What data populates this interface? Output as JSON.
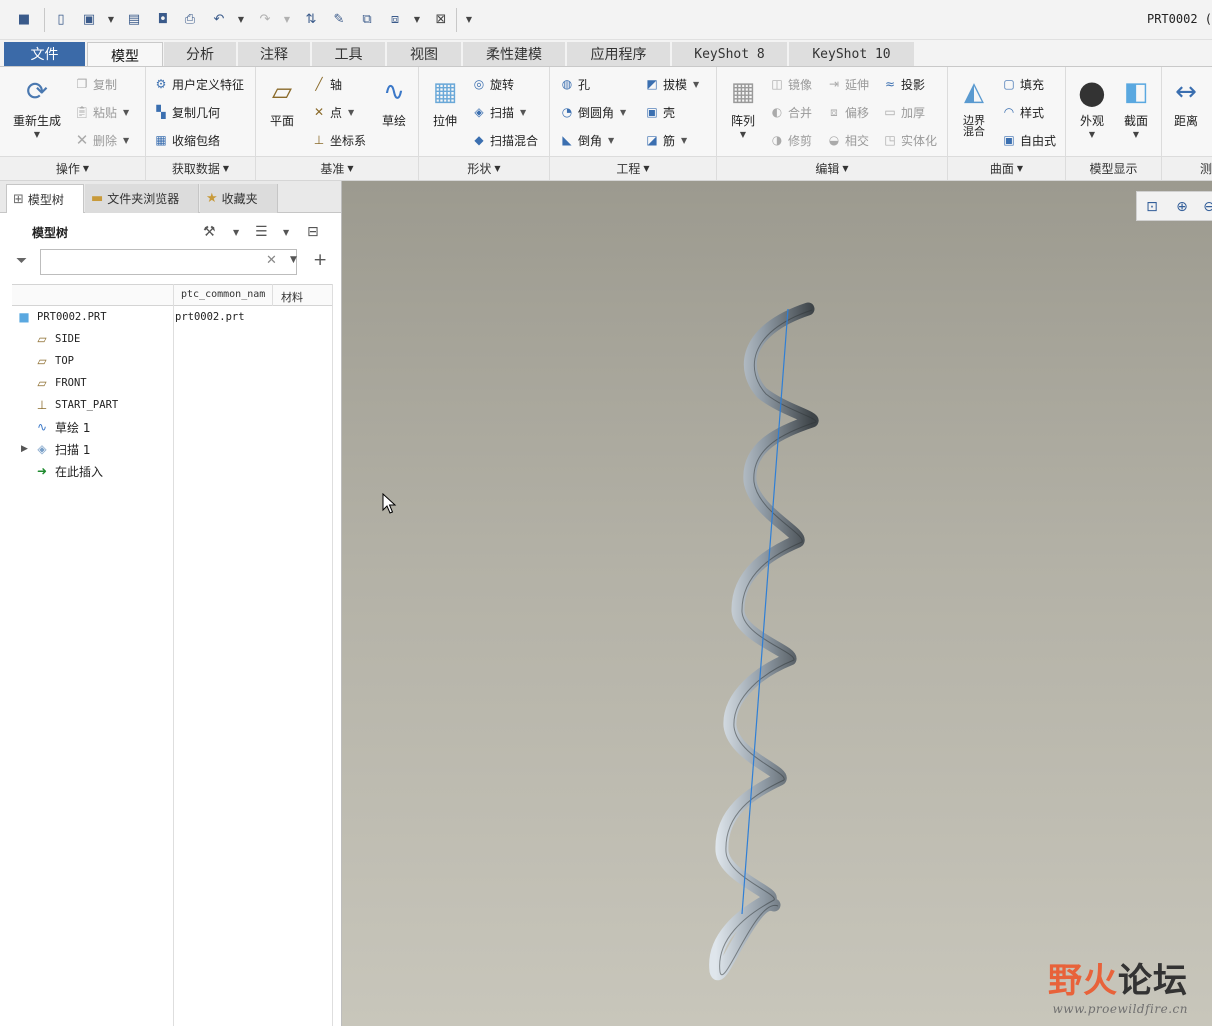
{
  "window": {
    "title": "PRT0002 ("
  },
  "tabs": [
    {
      "label": "文件",
      "state": "file"
    },
    {
      "label": "模型",
      "state": "active"
    },
    {
      "label": "分析"
    },
    {
      "label": "注释"
    },
    {
      "label": "工具"
    },
    {
      "label": "视图"
    },
    {
      "label": "柔性建模"
    },
    {
      "label": "应用程序"
    },
    {
      "label": "KeyShot 8"
    },
    {
      "label": "KeyShot 10"
    }
  ],
  "ribbon": {
    "operations": {
      "label": "操作",
      "regenerate": "重新生成",
      "copy": "复制",
      "paste": "粘贴",
      "delete": "删除"
    },
    "get_data": {
      "label": "获取数据",
      "udf": "用户定义特征",
      "copy_geom": "复制几何",
      "shrinkwrap": "收缩包络"
    },
    "datum": {
      "label": "基准",
      "plane": "平面",
      "axis": "轴",
      "point": "点",
      "csys": "坐标系",
      "sketch": "草绘"
    },
    "shapes": {
      "label": "形状",
      "extrude": "拉伸",
      "revolve": "旋转",
      "sweep": "扫描",
      "swept_blend": "扫描混合"
    },
    "engineering": {
      "label": "工程",
      "hole": "孔",
      "round": "倒圆角",
      "chamfer": "倒角",
      "draft": "拔模",
      "shell": "壳",
      "rib": "筋"
    },
    "editing": {
      "label": "编辑",
      "pattern": "阵列",
      "mirror": "镜像",
      "merge": "合并",
      "trim": "修剪",
      "extend": "延伸",
      "offset": "偏移",
      "intersect": "相交",
      "project": "投影",
      "thicken": "加厚",
      "solidify": "实体化"
    },
    "surfaces": {
      "label": "曲面",
      "boundary_blend": "边界混合",
      "fill": "填充",
      "style": "样式",
      "freestyle": "自由式"
    },
    "model_display": {
      "label": "模型显示",
      "appearance": "外观",
      "section": "截面"
    },
    "measure": {
      "label": "测",
      "distance": "距离"
    }
  },
  "panel": {
    "tabs": [
      "模型树",
      "文件夹浏览器",
      "收藏夹"
    ],
    "tree_title": "模型树",
    "filter_placeholder": "",
    "columns": {
      "name": "ptc_common_nam",
      "material": "材料"
    },
    "rows": [
      {
        "label": "PRT0002.PRT",
        "icon": "part-icon"
      },
      {
        "label": "SIDE",
        "icon": "datum-plane-icon"
      },
      {
        "label": "TOP",
        "icon": "datum-plane-icon"
      },
      {
        "label": "FRONT",
        "icon": "datum-plane-icon"
      },
      {
        "label": "START_PART",
        "icon": "csys-icon"
      },
      {
        "label": "草绘 1",
        "icon": "sketch-icon"
      },
      {
        "label": "扫描 1",
        "icon": "sweep-icon"
      },
      {
        "label": "在此插入",
        "icon": "insert-here-icon"
      }
    ],
    "common_name_value": "prt0002.prt"
  },
  "watermark": {
    "brand_a": "野",
    "brand_b": "火",
    "brand_c": "论坛",
    "url": "www.proewildfire.cn"
  },
  "colors": {
    "file_tab": "#3b6aa8",
    "axis_line": "#2f7fd6",
    "accent_red": "#e8623a"
  }
}
